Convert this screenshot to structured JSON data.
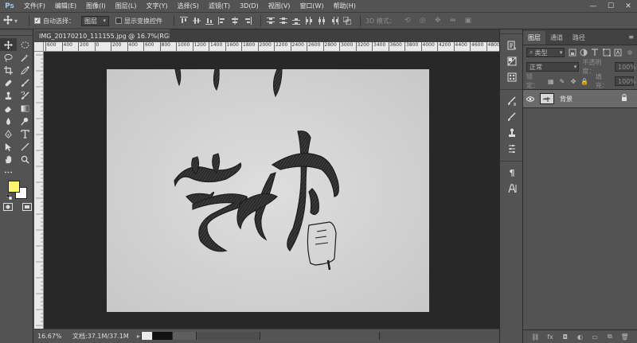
{
  "app": {
    "logo": "Ps"
  },
  "menu": [
    "文件(F)",
    "编辑(E)",
    "图像(I)",
    "图层(L)",
    "文字(Y)",
    "选择(S)",
    "滤镜(T)",
    "3D(D)",
    "视图(V)",
    "窗口(W)",
    "帮助(H)"
  ],
  "window_controls": {
    "minimize": "—",
    "maximize": "☐",
    "close": "✕"
  },
  "options": {
    "auto_select_label": "自动选择：",
    "auto_select_checked": true,
    "auto_select_target": "图层",
    "show_transform_label": "显示变换控件",
    "show_transform_checked": false,
    "mode_3d_label": "3D 模式："
  },
  "document": {
    "tab_title": "IMG_20170210_111155.jpg @ 16.7%(RGB/8)",
    "close_glyph": "×"
  },
  "ruler": {
    "h_labels": [
      "600",
      "400",
      "200",
      "0",
      "200",
      "400",
      "600",
      "800",
      "1000",
      "1200",
      "1400",
      "1600",
      "1800",
      "2000",
      "2200",
      "2400",
      "2600",
      "2800",
      "3000",
      "3200",
      "3400",
      "3600",
      "3800",
      "4000",
      "4200",
      "4400",
      "4600",
      "4800"
    ]
  },
  "status": {
    "zoom": "16.67%",
    "doc_info": "文档:37.1M/37.1M",
    "arrow": "▸"
  },
  "colors": {
    "foreground": "#fcf66b",
    "background": "#ffffff",
    "ui_bg": "#535353",
    "canvas_bg": "#282828",
    "paper": "#d8d8d8"
  },
  "layers_panel": {
    "tabs": [
      "图层",
      "通道",
      "路径"
    ],
    "menu_glyph": "≡",
    "kind_label": "类型",
    "blend_mode": "正常",
    "opacity_label": "不透明度：",
    "opacity_value": "100%",
    "lock_label": "锁定：",
    "fill_label": "填充：",
    "fill_value": "100%",
    "layers": [
      {
        "name": "背景",
        "visible": true,
        "locked": true
      }
    ],
    "footer_icons": [
      "link-icon",
      "fx-icon",
      "mask-icon",
      "adjustment-icon",
      "folder-icon",
      "new-layer-icon",
      "trash-icon"
    ],
    "footer_glyphs": [
      "⛓",
      "fx",
      "◘",
      "◐",
      "▭",
      "⧉",
      "🗑"
    ]
  }
}
